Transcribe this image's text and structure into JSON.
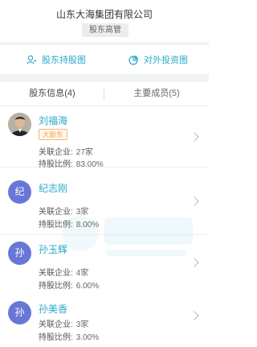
{
  "header": {
    "company_name": "山东大海集团有限公司",
    "role_tag": "股东高管"
  },
  "actions": {
    "shareholding_chart": "股东持股图",
    "investment_chart": "对外投资图"
  },
  "tabs": [
    {
      "label": "股东信息(4)"
    },
    {
      "label": "主要成员(5)"
    }
  ],
  "labels": {
    "related_companies": "关联企业:",
    "share_ratio": "持股比例:"
  },
  "shareholders": [
    {
      "name": "刘福海",
      "avatar": "",
      "badge": "大股东",
      "related": "27家",
      "ratio": "83.00%"
    },
    {
      "name": "纪志刚",
      "avatar": "纪",
      "badge": "",
      "related": "3家",
      "ratio": "8.00%"
    },
    {
      "name": "孙玉辉",
      "avatar": "孙",
      "badge": "",
      "related": "4家",
      "ratio": "6.00%"
    },
    {
      "name": "孙美香",
      "avatar": "孙",
      "badge": "",
      "related": "3家",
      "ratio": "3.00%"
    }
  ],
  "colors": {
    "accent": "#2aa9c9",
    "avatar_bg": "#6677d6",
    "badge_border": "#f2b77a",
    "badge_text": "#f0a055"
  }
}
